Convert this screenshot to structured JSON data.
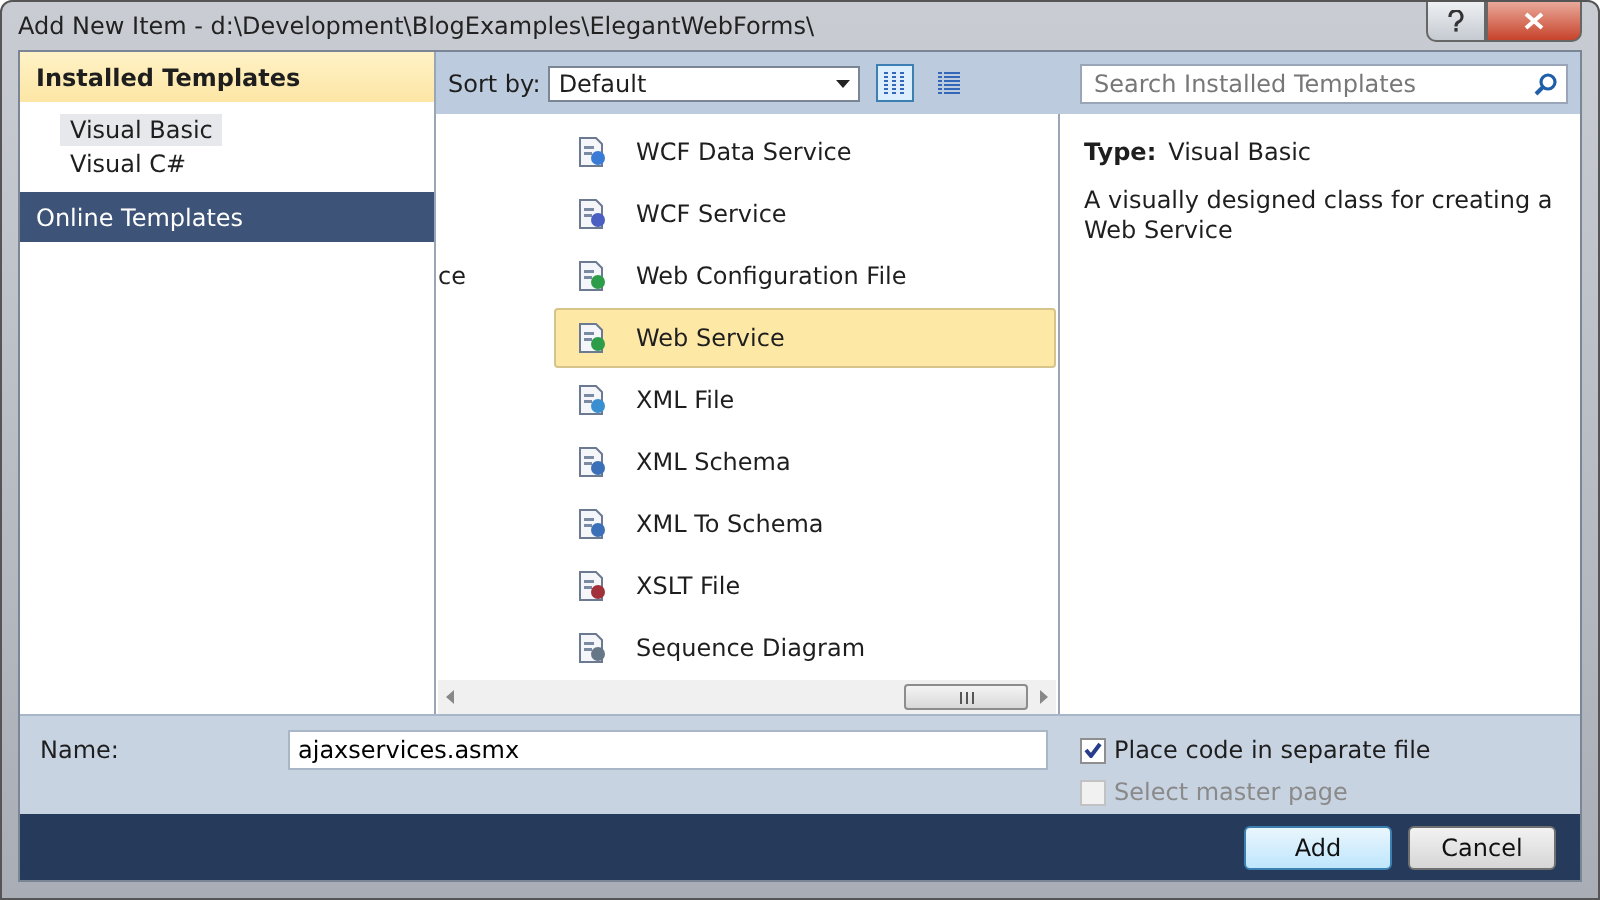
{
  "window": {
    "title": "Add New Item - d:\\Development\\BlogExamples\\ElegantWebForms\\"
  },
  "sidebar": {
    "sections": [
      {
        "label": "Installed Templates",
        "expanded": true,
        "items": [
          {
            "label": "Visual Basic",
            "selected": true
          },
          {
            "label": "Visual C#",
            "selected": false
          }
        ]
      },
      {
        "label": "Online Templates",
        "expanded": false
      }
    ]
  },
  "toolbar": {
    "sort_label": "Sort by:",
    "sort_value": "Default",
    "view_buttons": [
      {
        "selected": true
      },
      {
        "selected": false
      }
    ],
    "search": {
      "placeholder": "Search Installed Templates"
    }
  },
  "templates": [
    {
      "name": "WCF Data Service",
      "selected": false
    },
    {
      "name": "WCF Service",
      "selected": false
    },
    {
      "name": "Web Configuration File",
      "selected": false,
      "column_1": "ce"
    },
    {
      "name": "Web Service",
      "selected": true
    },
    {
      "name": "XML File",
      "selected": false
    },
    {
      "name": "XML Schema",
      "selected": false
    },
    {
      "name": "XML To Schema",
      "selected": false
    },
    {
      "name": "XSLT File",
      "selected": false
    },
    {
      "name": "Sequence Diagram",
      "selected": false
    }
  ],
  "details": {
    "type_label": "Type:",
    "type_value": "Visual Basic",
    "description": "A visually designed class for creating a Web Service"
  },
  "form": {
    "name_label": "Name:",
    "name_value": "ajaxservices.asmx",
    "options": [
      {
        "label": "Place code in separate file",
        "checked": true,
        "disabled": false
      },
      {
        "label": "Select master page",
        "checked": false,
        "disabled": true
      }
    ]
  },
  "buttons": [
    {
      "label": "Add",
      "kind": "default"
    },
    {
      "label": "Cancel",
      "kind": "normal"
    }
  ]
}
